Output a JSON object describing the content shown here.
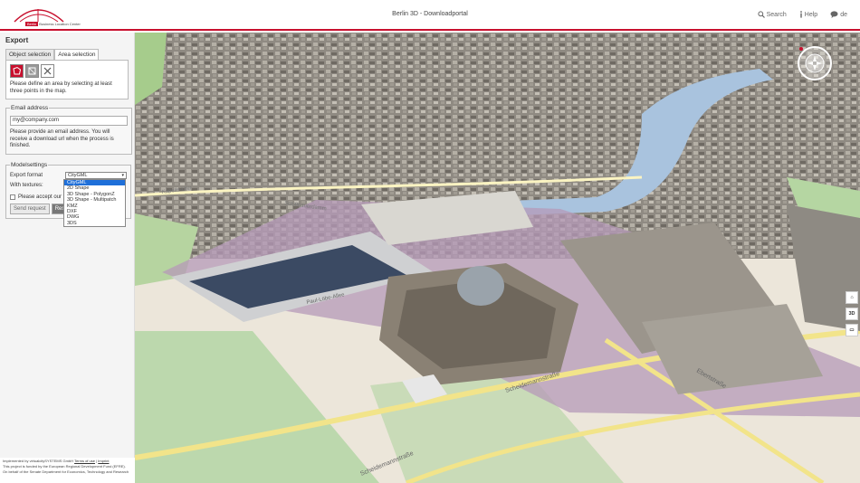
{
  "header": {
    "logo_badge": "Berlin",
    "logo_text": "Business Location Center",
    "title": "Berlin 3D - Downloadportal",
    "nav": {
      "search": "Search",
      "help": "Help",
      "lang": "de"
    },
    "accent": "#c8102e"
  },
  "sidebar": {
    "title": "Export",
    "tabs": [
      {
        "label": "Object selection"
      },
      {
        "label": "Area selection"
      }
    ],
    "area_instruction": "Please define an area by selecting at least three points in the map.",
    "tools": [
      "polygon-icon",
      "square-select-icon",
      "clear-icon"
    ],
    "email": {
      "legend": "Email address",
      "value": "my@company.com",
      "info": "Please provide an email address. You will receive a download url when the process is finished."
    },
    "model": {
      "legend": "Modelsettings",
      "export_format_label": "Export format",
      "export_format_value": "CityGML",
      "textures_label": "With textures:",
      "formats": [
        "CityGML",
        "2D Shape",
        "3D Shape - PolygonZ",
        "3D Shape - Multipatch",
        "KMZ",
        "DXF",
        "DWG",
        "3DS"
      ],
      "terms_label": "Please accept our t",
      "send_label": "Send request",
      "reset_label": "Reset"
    }
  },
  "footer": {
    "line1_prefix": "Implemented by virtualcitySYSTEMS GmbH",
    "terms_link": "Terms of use",
    "imprint_link": "Imprint",
    "line2": "This project is funded by the European Regional Development Fund (EFRE).",
    "line3": "On behalf of the Senate Department for Economics, Technology and Research"
  },
  "map": {
    "streets": [
      "Kapelle-Ufer",
      "Schiffbauerdamm",
      "Paul-Löbe-Allee",
      "Scheidemannstraße",
      "Ebertstraße",
      "Scheidemannstraße"
    ],
    "buttons": {
      "home": "⌂",
      "mode": "3D",
      "map": "▭"
    }
  }
}
